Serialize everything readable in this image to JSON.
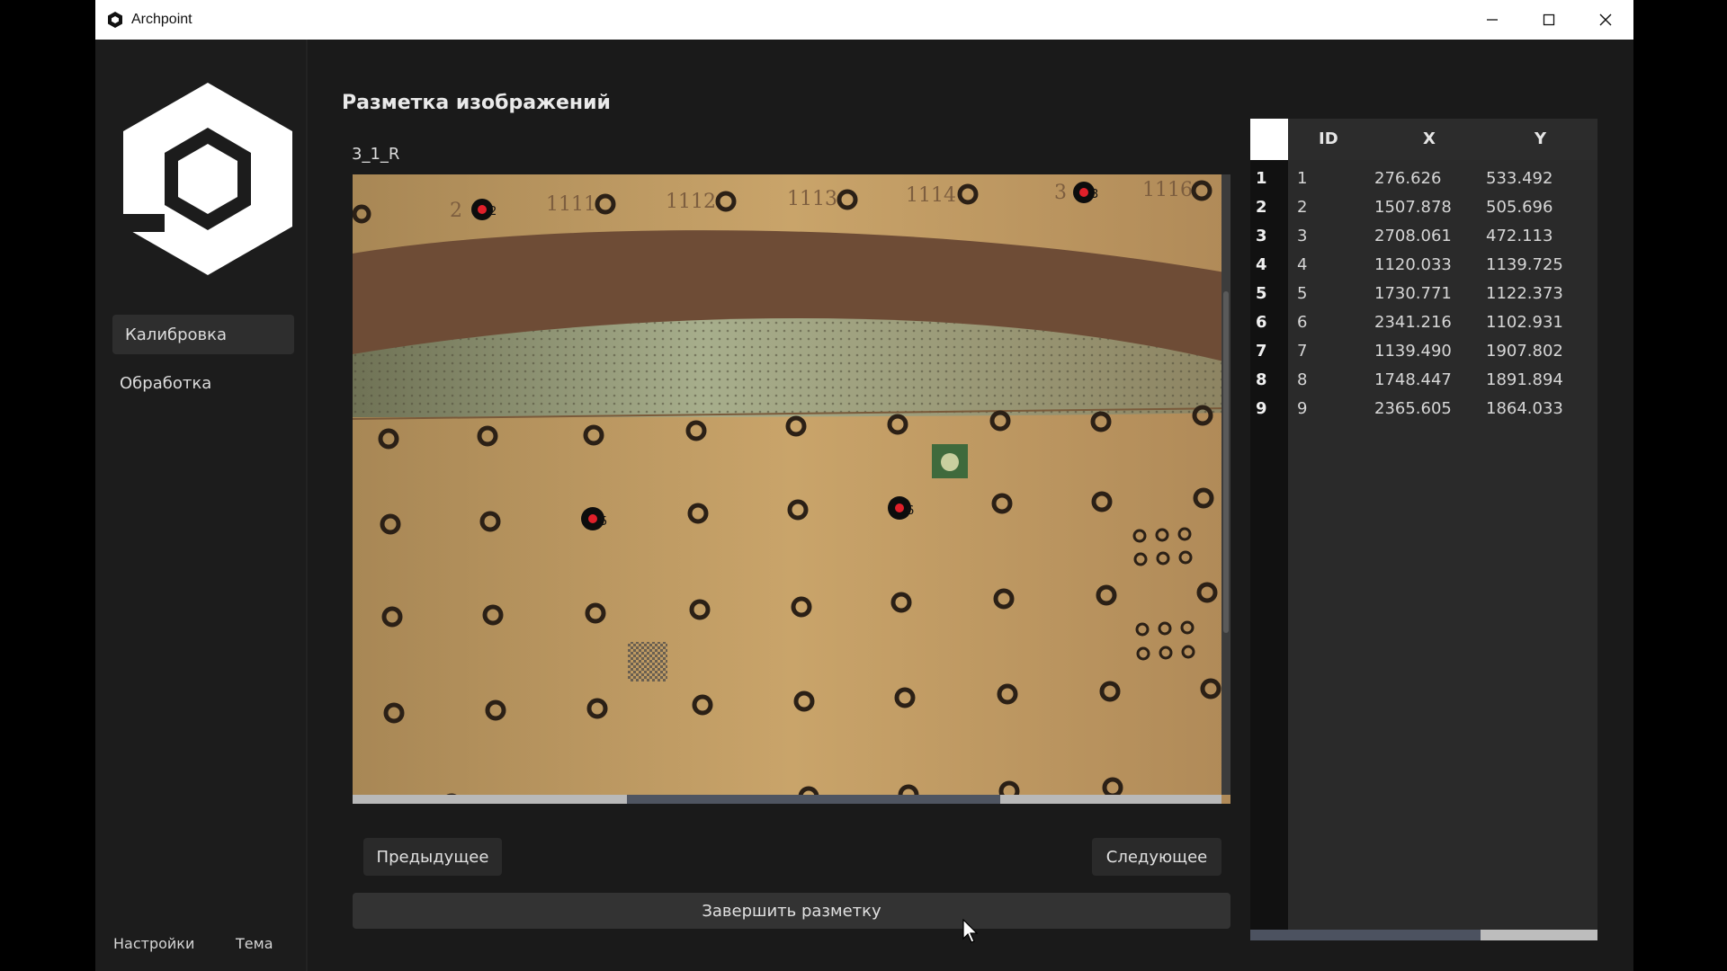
{
  "window": {
    "title": "Archpoint"
  },
  "sidebar": {
    "items": [
      {
        "label": "Калибровка",
        "active": true
      },
      {
        "label": "Обработка",
        "active": false
      }
    ],
    "footer": {
      "settings": "Настройки",
      "theme": "Тема"
    }
  },
  "main": {
    "title": "Разметка изображений",
    "image_name": "3_1_R",
    "buttons": {
      "prev": "Предыдущее",
      "next": "Следующее",
      "finish": "Завершить разметку"
    }
  },
  "marked_points": [
    {
      "id": "2"
    },
    {
      "id": "3"
    },
    {
      "id": "5"
    },
    {
      "id": "6"
    }
  ],
  "table": {
    "columns": [
      "ID",
      "X",
      "Y"
    ],
    "rows": [
      {
        "row": "1",
        "id": "1",
        "x": "276.626",
        "y": "533.492"
      },
      {
        "row": "2",
        "id": "2",
        "x": "1507.878",
        "y": "505.696"
      },
      {
        "row": "3",
        "id": "3",
        "x": "2708.061",
        "y": "472.113"
      },
      {
        "row": "4",
        "id": "4",
        "x": "1120.033",
        "y": "1139.725"
      },
      {
        "row": "5",
        "id": "5",
        "x": "1730.771",
        "y": "1122.373"
      },
      {
        "row": "6",
        "id": "6",
        "x": "2341.216",
        "y": "1102.931"
      },
      {
        "row": "7",
        "id": "7",
        "x": "1139.490",
        "y": "1907.802"
      },
      {
        "row": "8",
        "id": "8",
        "x": "1748.447",
        "y": "1891.894"
      },
      {
        "row": "9",
        "id": "9",
        "x": "2365.605",
        "y": "1864.033"
      }
    ]
  },
  "colors": {
    "accent": "#ffffff",
    "background": "#1a1a1a",
    "marker": "#e0202a"
  }
}
